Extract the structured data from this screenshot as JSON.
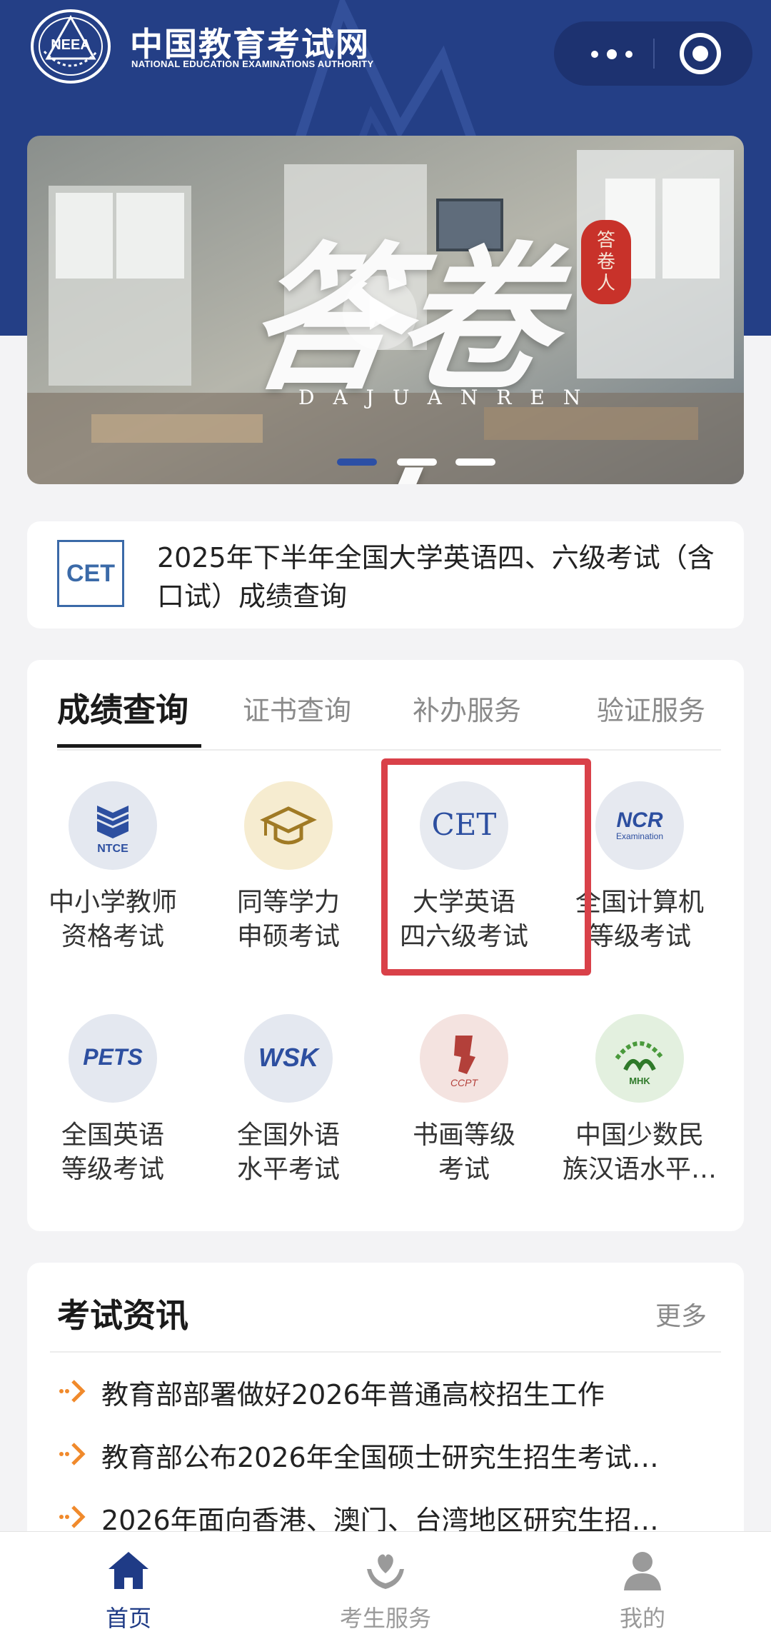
{
  "header": {
    "logo_badge_text": "NEEA",
    "title": "中国教育考试网",
    "subtitle": "NATIONAL EDUCATION EXAMINATIONS AUTHORITY",
    "more_icon": "more-dots-icon",
    "close_icon": "target-circle-icon"
  },
  "banner": {
    "title": "答卷人",
    "subtitle": "DAJUANREN",
    "seal_text": "答卷人",
    "play_icon": "play-icon",
    "slides": 3,
    "active_slide": 1
  },
  "notice": {
    "icon_text": "CET",
    "text": "2025年下半年全国大学英语四、六级考试（含口试）成绩查询"
  },
  "services": {
    "tabs": [
      {
        "label": "成绩查询",
        "active": true
      },
      {
        "label": "证书查询",
        "active": false
      },
      {
        "label": "补办服务",
        "active": false
      },
      {
        "label": "验证服务",
        "active": false
      }
    ],
    "items": [
      {
        "icon": "ntce-icon",
        "icon_text": "NTCE",
        "line1": "中小学教师",
        "line2": "资格考试"
      },
      {
        "icon": "graduation-cap-icon",
        "icon_text": "",
        "line1": "同等学力",
        "line2": "申硕考试"
      },
      {
        "icon": "cet-icon",
        "icon_text": "CET",
        "line1": "大学英语",
        "line2": "四六级考试"
      },
      {
        "icon": "ncre-icon",
        "icon_text": "NCR",
        "icon_subtext": "Examination",
        "line1": "全国计算机",
        "line2": "等级考试"
      },
      {
        "icon": "pets-icon",
        "icon_text": "PETS",
        "line1": "全国英语",
        "line2": "等级考试"
      },
      {
        "icon": "wsk-icon",
        "icon_text": "WSK",
        "line1": "全国外语",
        "line2": "水平考试"
      },
      {
        "icon": "ccpt-icon",
        "icon_text": "CCPT",
        "line1": "书画等级",
        "line2": "考试"
      },
      {
        "icon": "mhk-icon",
        "icon_text": "MHK",
        "line1": "中国少数民",
        "line2": "族汉语水平…"
      }
    ],
    "highlight_color": "#d94149"
  },
  "news": {
    "title": "考试资讯",
    "more": "更多",
    "items": [
      "教育部部署做好2026年普通高校招生工作",
      "教育部公布2026年全国硕士研究生招生考试…",
      "2026年面向香港、澳门、台湾地区研究生招…"
    ],
    "arrow_color": "#f08a2c"
  },
  "bottom_nav": [
    {
      "label": "首页",
      "icon": "home-icon",
      "active": true
    },
    {
      "label": "考生服务",
      "icon": "heart-hands-icon",
      "active": false
    },
    {
      "label": "我的",
      "icon": "user-icon",
      "active": false
    }
  ],
  "colors": {
    "brand_blue": "#243f86",
    "nav_active": "#1f3b86"
  }
}
